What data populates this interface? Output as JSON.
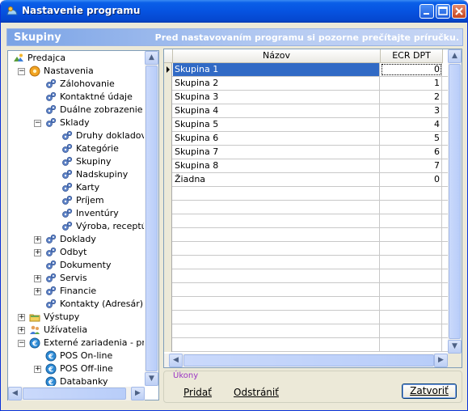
{
  "window": {
    "title": "Nastavenie programu"
  },
  "header": {
    "title": "Skupiny",
    "note": "Pred nastavovaním programu si pozorne prečítajte príručku."
  },
  "tree": [
    {
      "label": "Predajca",
      "level": 0,
      "icon": "app-icon",
      "expander": ""
    },
    {
      "label": "Nastavenia",
      "level": 1,
      "icon": "settings-orange-icon",
      "expander": "-"
    },
    {
      "label": "Zálohovanie",
      "level": 2,
      "icon": "gear-icon",
      "expander": ""
    },
    {
      "label": "Kontaktné údaje",
      "level": 2,
      "icon": "gear-icon",
      "expander": ""
    },
    {
      "label": "Duálne zobrazenie",
      "level": 2,
      "icon": "gear-icon",
      "expander": ""
    },
    {
      "label": "Sklady",
      "level": 2,
      "icon": "gear-icon",
      "expander": "-"
    },
    {
      "label": "Druhy dokladov",
      "level": 3,
      "icon": "gear-icon",
      "expander": ""
    },
    {
      "label": "Kategórie",
      "level": 3,
      "icon": "gear-icon",
      "expander": ""
    },
    {
      "label": "Skupiny",
      "level": 3,
      "icon": "gear-icon",
      "expander": ""
    },
    {
      "label": "Nadskupiny",
      "level": 3,
      "icon": "gear-icon",
      "expander": ""
    },
    {
      "label": "Karty",
      "level": 3,
      "icon": "gear-icon",
      "expander": ""
    },
    {
      "label": "Príjem",
      "level": 3,
      "icon": "gear-icon",
      "expander": ""
    },
    {
      "label": "Inventúry",
      "level": 3,
      "icon": "gear-icon",
      "expander": ""
    },
    {
      "label": "Výroba, receptúr",
      "level": 3,
      "icon": "gear-icon",
      "expander": ""
    },
    {
      "label": "Doklady",
      "level": 2,
      "icon": "gear-icon",
      "expander": "+"
    },
    {
      "label": "Odbyt",
      "level": 2,
      "icon": "gear-icon",
      "expander": "+"
    },
    {
      "label": "Dokumenty",
      "level": 2,
      "icon": "gear-icon",
      "expander": ""
    },
    {
      "label": "Servis",
      "level": 2,
      "icon": "gear-icon",
      "expander": "+"
    },
    {
      "label": "Financie",
      "level": 2,
      "icon": "gear-icon",
      "expander": "+"
    },
    {
      "label": "Kontakty (Adresár)",
      "level": 2,
      "icon": "gear-icon",
      "expander": ""
    },
    {
      "label": "Výstupy",
      "level": 1,
      "icon": "folder-icon",
      "expander": "+"
    },
    {
      "label": "Užívatelia",
      "level": 1,
      "icon": "users-icon",
      "expander": "+"
    },
    {
      "label": "Externé zariadenia - preda",
      "level": 1,
      "icon": "euro-icon",
      "expander": "-"
    },
    {
      "label": "POS On-line",
      "level": 2,
      "icon": "euro-icon",
      "expander": ""
    },
    {
      "label": "POS Off-line",
      "level": 2,
      "icon": "euro-icon",
      "expander": "+"
    },
    {
      "label": "Databanky",
      "level": 2,
      "icon": "euro-icon",
      "expander": ""
    }
  ],
  "grid": {
    "columns": [
      "Názov",
      "ECR DPT"
    ],
    "rows": [
      {
        "name": "Skupina 1",
        "dpt": "0",
        "selected": true
      },
      {
        "name": "Skupina 2",
        "dpt": "1",
        "selected": false
      },
      {
        "name": "Skupina 3",
        "dpt": "2",
        "selected": false
      },
      {
        "name": "Skupina 4",
        "dpt": "3",
        "selected": false
      },
      {
        "name": "Skupina 5",
        "dpt": "4",
        "selected": false
      },
      {
        "name": "Skupina 6",
        "dpt": "5",
        "selected": false
      },
      {
        "name": "Skupina 7",
        "dpt": "6",
        "selected": false
      },
      {
        "name": "Skupina 8",
        "dpt": "7",
        "selected": false
      },
      {
        "name": "Žiadna",
        "dpt": "0",
        "selected": false
      }
    ],
    "empty_rows": 12
  },
  "actions": {
    "legend": "Úkony",
    "add": "Pridať",
    "remove": "Odstrániť",
    "close": "Zatvoriť"
  },
  "colors": {
    "selection": "#316ac5",
    "title_bar": "#0653e0",
    "header_band": "#7aa3e6"
  }
}
